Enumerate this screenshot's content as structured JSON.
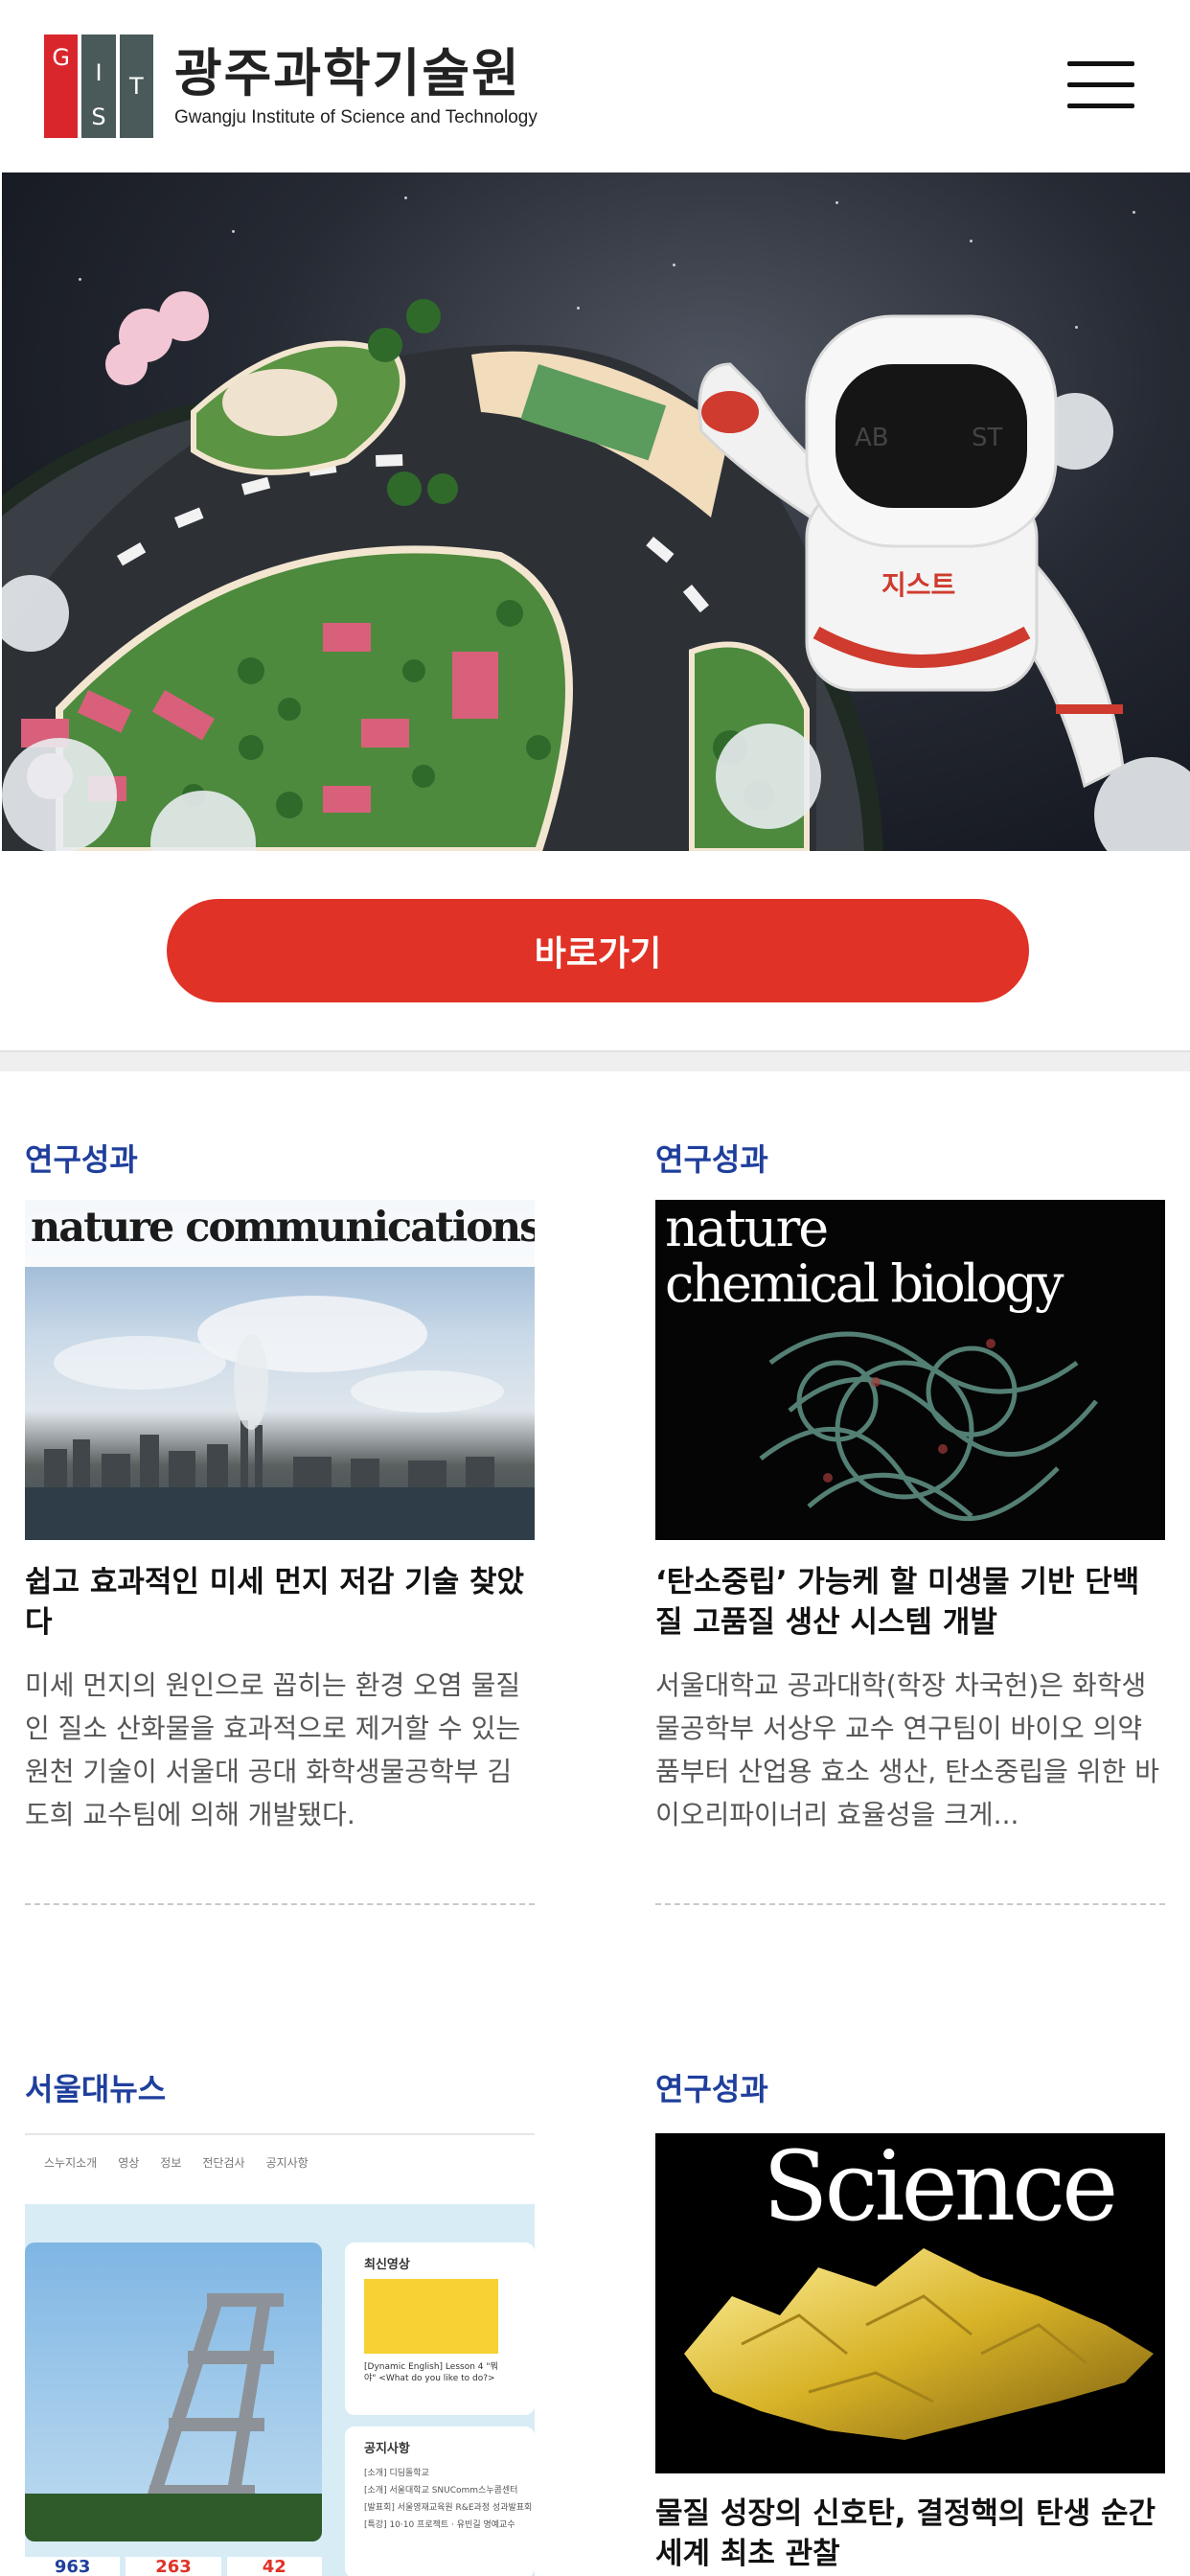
{
  "header": {
    "logo_mark_letters": [
      "G",
      "I",
      "S",
      "T"
    ],
    "name_ko": "광주과학기술원",
    "name_en": "Gwangju Institute of Science and Technology",
    "menu_icon": "hamburger-menu-icon"
  },
  "hero": {
    "visor_left": "AB",
    "visor_right": "ST",
    "chest_text": "지스트"
  },
  "cta": {
    "label": "바로가기"
  },
  "cards": [
    {
      "category": "연구성과",
      "thumb_text": "nature communications",
      "title": "쉽고 효과적인 미세 먼지 저감 기술 찾았다",
      "summary": "미세 먼지의 원인으로 꼽히는 환경 오염 물질인 질소 산화물을 효과적으로 제거할 수 있는 원천 기술이 서울대 공대 화학생물공학부 김도희 교수팀에 의해 개발됐다."
    },
    {
      "category": "연구성과",
      "thumb_text_1": "nature",
      "thumb_text_2": "chemical biology",
      "title": "‘탄소중립’ 가능케 할 미생물 기반 단백질 고품질 생산 시스템 개발",
      "summary": "서울대학교 공과대학(학장 차국헌)은 화학생물공학부 서상우 교수 연구팀이 바이오 의약품부터 산업용 효소 생산, 탄소중립을 위한 바이오리파이너리 효율성을 크게..."
    },
    {
      "category": "서울대뉴스",
      "thumb_nav": [
        "스누지소개",
        "영상",
        "정보",
        "전단검사",
        "공지사항"
      ],
      "thumb_panel_1": "최신영상",
      "thumb_panel_1_text": "[Dynamic English] Lesson 4 \"뭐야\" <What do you like to do?>",
      "thumb_panel_2": "공지사항",
      "thumb_panel_2_items": [
        "[소개] 디딤돌학교",
        "[소개] 서울대학교 SNUComm스누콤센터",
        "[발표회] 서울영재교육원 R&E과정 성과발표회",
        "[특강] 10·10 프로젝트 · 유빈길 명예교수"
      ],
      "thumb_counters": [
        "963",
        "263",
        "42"
      ]
    },
    {
      "category": "연구성과",
      "thumb_text": "Science",
      "title": "물질 성장의 신호탄, 결정핵의 탄생 순간 세계 최초 관찰"
    }
  ],
  "colors": {
    "accent_red": "#e03226",
    "category_blue": "#1f3f9c",
    "logo_red": "#d9262d",
    "logo_gray": "#4a5a5a"
  }
}
